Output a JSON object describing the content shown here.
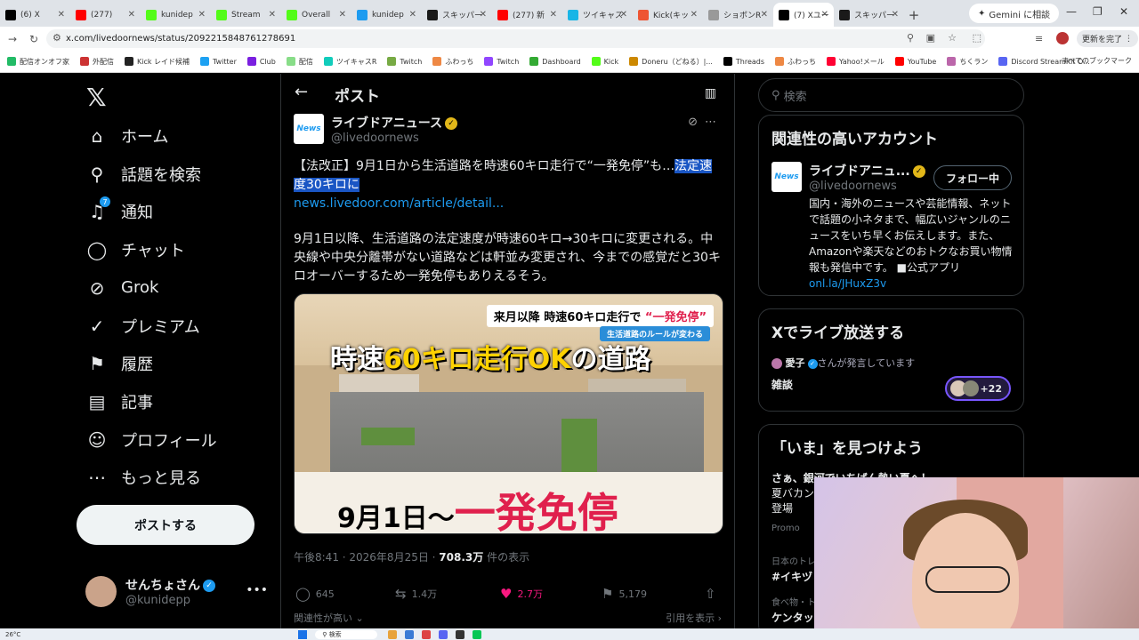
{
  "browser": {
    "tabs": [
      {
        "label": "(6) X",
        "color": "#000000"
      },
      {
        "label": "(277)",
        "color": "#ff0000"
      },
      {
        "label": "kunidep",
        "color": "#53fc18"
      },
      {
        "label": "Stream",
        "color": "#53fc18"
      },
      {
        "label": "Overall",
        "color": "#53fc18"
      },
      {
        "label": "kunidep",
        "color": "#1d9bf0"
      },
      {
        "label": "スキッパー",
        "color": "#1a1a1a"
      },
      {
        "label": "(277) 新",
        "color": "#ff0000"
      },
      {
        "label": "ツイキャス",
        "color": "#19b5e6"
      },
      {
        "label": "Kick(キッ",
        "color": "#e53"
      },
      {
        "label": "ショボンR",
        "color": "#999999"
      },
      {
        "label": "(7) Xユー",
        "color": "#000000"
      },
      {
        "label": "スキッパー",
        "color": "#1a1a1a"
      }
    ],
    "gemini_label": "Gemini に相談",
    "url": "x.com/livedoornews/status/2092215848761278691",
    "update_label": "更新を完了",
    "bookmarks": [
      "配信オンオフ家",
      "外配信",
      "Kick レイド候補",
      "Twitter",
      "Club",
      "配信",
      "ツイキャスR",
      "Twitch",
      "ふわっち",
      "Twitch",
      "Dashboard",
      "Kick",
      "Doneru（どねる）|...",
      "Threads",
      "ふわっち",
      "Yahoo!メール",
      "YouTube",
      "ちくラン",
      "Discord StreamKit O..."
    ],
    "bookmarks_all": "すべてのブックマーク"
  },
  "nav": {
    "items": [
      {
        "label": "ホーム",
        "icon": "home-icon",
        "glyph": "⌂"
      },
      {
        "label": "話題を検索",
        "icon": "search-icon",
        "glyph": "⚲"
      },
      {
        "label": "通知",
        "icon": "bell-icon",
        "glyph": "♫",
        "badge": "7"
      },
      {
        "label": "チャット",
        "icon": "chat-icon",
        "glyph": "◯"
      },
      {
        "label": "Grok",
        "icon": "grok-icon",
        "glyph": "⊘"
      },
      {
        "label": "プレミアム",
        "icon": "premium-icon",
        "glyph": "✓"
      },
      {
        "label": "履歴",
        "icon": "bookmark-icon",
        "glyph": "⚑"
      },
      {
        "label": "記事",
        "icon": "article-icon",
        "glyph": "▤"
      },
      {
        "label": "プロフィール",
        "icon": "profile-icon",
        "glyph": "☺"
      },
      {
        "label": "もっと見る",
        "icon": "more-icon",
        "glyph": "⋯"
      }
    ],
    "post_button": "ポストする",
    "me": {
      "name": "せんちょさん",
      "handle": "@kunidepp"
    }
  },
  "post": {
    "header_title": "ポスト",
    "author_name": "ライブドアニュース",
    "author_handle": "@livedoornews",
    "logo_text": "News",
    "text1_a": "【法改正】9月1日から生活道路を時速60キロ走行で“一発免停”も…",
    "text1_sel": "法定速度30キロに",
    "link": "news.livedoor.com/article/detail...",
    "text2": "9月1日以降、生活道路の法定速度が時速60キロ→30キロに変更される。中央線や中央分離帯がない道路などは軒並み変更され、今までの感覚だと30キロオーバーするため一発免停もありえるそう。",
    "media": {
      "top_caption_a": "来月以降 時速60キロ走行で",
      "top_caption_b": "“一発免停”",
      "sub_caption": "生活道路のルールが変わる",
      "title_a": "時速",
      "title_b": "60キロ走行OK",
      "title_c": "の道路",
      "bottom_a": "9月1日～",
      "bottom_b": "一発免停"
    },
    "meta_time": "午後8:41 · 2026年8月25日 · ",
    "meta_views": "708.3万",
    "meta_views_suffix": " 件の表示",
    "replies": "645",
    "reposts": "1.4万",
    "likes": "2.7万",
    "bookmarks": "5,179",
    "relevant": "関連性が高い",
    "quotes": "引用を表示"
  },
  "sidebar": {
    "search_placeholder": "検索",
    "related_title": "関連性の高いアカウント",
    "related_name": "ライブドアニュ...",
    "related_handle": "@livedoornews",
    "follow_label": "フォロー中",
    "bio_text": "国内・海外のニュースや芸能情報、ネットで話題の小ネタまで、幅広いジャンルのニュースをいち早くお伝えします。また、Amazonや楽天などのおトクなお買い物情報も発信中です。 ■公式アプリ",
    "bio_link": "onl.la/JHuxZ3v",
    "live_title": "Xでライブ放送する",
    "live_user": "愛子",
    "live_user_suffix": "さんが発言しています",
    "live_topic": "雑談",
    "live_count": "+22",
    "explore_title": "「いま」を見つけよう",
    "trends": [
      {
        "line1": "さぁ、銀河でいちばん熱い夏へ！",
        "line2": "夏バカンス",
        "line3": "登場"
      },
      {
        "line1": "Promo",
        "line2": "",
        "line3": ""
      },
      {
        "line1": "日本のトレ",
        "line2": "#イキヅ",
        "line3": ""
      },
      {
        "line1": "食べ物・ト",
        "line2": "ケンタッ",
        "line3": ""
      }
    ]
  },
  "taskbar": {
    "temp": "26°C",
    "search": "検索"
  }
}
